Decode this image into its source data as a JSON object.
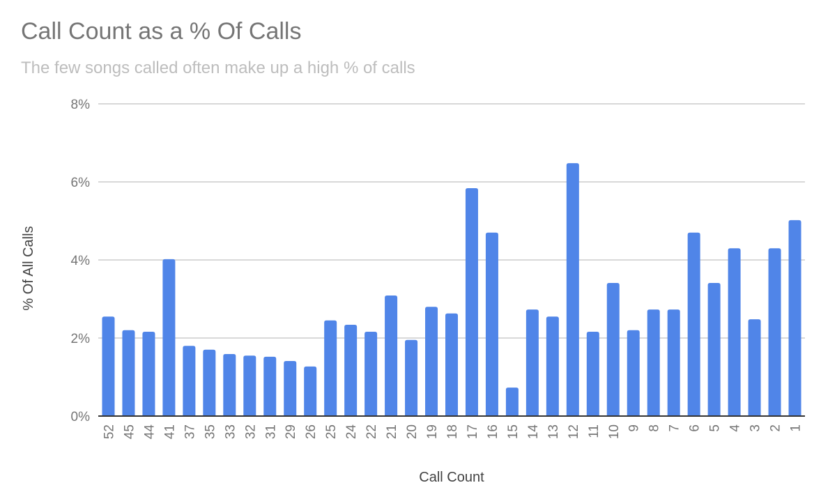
{
  "chart_data": {
    "type": "bar",
    "title": "Call Count as a % Of Calls",
    "subtitle": "The few songs called often make up a high % of calls",
    "xlabel": "Call Count",
    "ylabel": "% Of All Calls",
    "ylim": [
      0,
      8
    ],
    "yticks": [
      0,
      2,
      4,
      6,
      8
    ],
    "ytick_labels": [
      "0%",
      "2%",
      "4%",
      "6%",
      "8%"
    ],
    "grid": true,
    "legend": "none",
    "bar_color": "#5085E8",
    "categories": [
      "52",
      "45",
      "44",
      "41",
      "37",
      "35",
      "33",
      "32",
      "31",
      "29",
      "26",
      "25",
      "24",
      "22",
      "21",
      "20",
      "19",
      "18",
      "17",
      "16",
      "15",
      "14",
      "13",
      "12",
      "11",
      "10",
      "9",
      "8",
      "7",
      "6",
      "5",
      "4",
      "3",
      "2",
      "1"
    ],
    "values": [
      2.55,
      2.2,
      2.16,
      4.02,
      1.8,
      1.7,
      1.59,
      1.55,
      1.52,
      1.41,
      1.27,
      2.45,
      2.34,
      2.16,
      3.09,
      1.95,
      2.8,
      2.63,
      5.84,
      4.7,
      0.73,
      2.73,
      2.55,
      6.48,
      2.16,
      3.41,
      2.2,
      2.73,
      2.73,
      4.7,
      3.41,
      4.3,
      2.48,
      4.3,
      5.02
    ]
  }
}
